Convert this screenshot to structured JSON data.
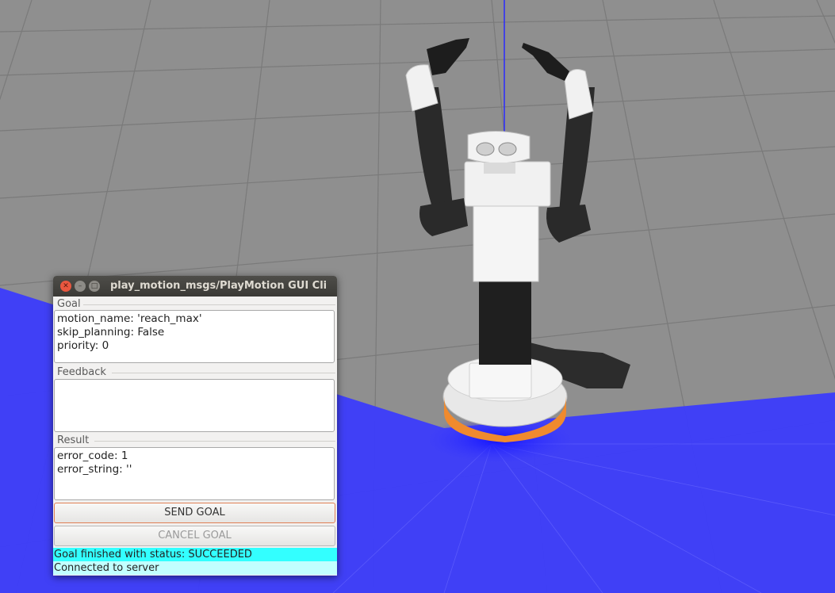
{
  "window": {
    "title": "play_motion_msgs/PlayMotion GUI Cli",
    "close_icon": "close-icon",
    "minimize_icon": "minimize-icon",
    "maximize_icon": "maximize-icon"
  },
  "goal": {
    "title": "Goal",
    "lines": [
      "motion_name: 'reach_max'",
      "skip_planning: False",
      "priority: 0"
    ]
  },
  "feedback": {
    "title": "Feedback",
    "lines": []
  },
  "result": {
    "title": "Result",
    "lines": [
      "error_code: 1",
      "error_string: ''"
    ]
  },
  "buttons": {
    "send_goal": "SEND GOAL",
    "cancel_goal": "CANCEL GOAL"
  },
  "status": {
    "finished": "Goal finished with status: SUCCEEDED",
    "connection": "Connected to server",
    "finished_color": "#33ffff",
    "connection_color": "#c2ffff"
  },
  "colors": {
    "floor_grid": "#8f8f8f",
    "laser_plane": "#3a3aff",
    "robot_base_accent": "#f08a2e"
  }
}
